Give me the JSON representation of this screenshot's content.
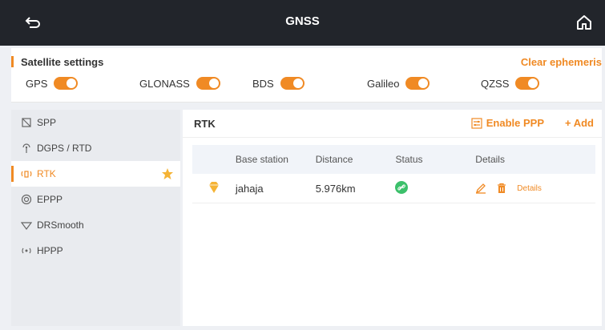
{
  "header": {
    "title": "GNSS"
  },
  "satellite": {
    "title": "Satellite settings",
    "clear_label": "Clear ephemeris",
    "systems": [
      {
        "label": "GPS",
        "enabled": true
      },
      {
        "label": "GLONASS",
        "enabled": true
      },
      {
        "label": "BDS",
        "enabled": true
      },
      {
        "label": "Galileo",
        "enabled": true
      },
      {
        "label": "QZSS",
        "enabled": true
      }
    ]
  },
  "sidebar": {
    "items": [
      {
        "label": "SPP"
      },
      {
        "label": "DGPS / RTD"
      },
      {
        "label": "RTK",
        "active": true
      },
      {
        "label": "EPPP"
      },
      {
        "label": "DRSmooth"
      },
      {
        "label": "HPPP"
      }
    ]
  },
  "main": {
    "title": "RTK",
    "enable_ppp_label": "Enable PPP",
    "add_label": "+ Add",
    "columns": [
      "Base station",
      "Distance",
      "Status",
      "Details"
    ],
    "rows": [
      {
        "base_station": "jahaja",
        "distance": "5.976km",
        "details_label": "Details"
      }
    ]
  },
  "colors": {
    "accent": "#f08a24",
    "topbar": "#22252b",
    "status_ok": "#3cc06b"
  }
}
